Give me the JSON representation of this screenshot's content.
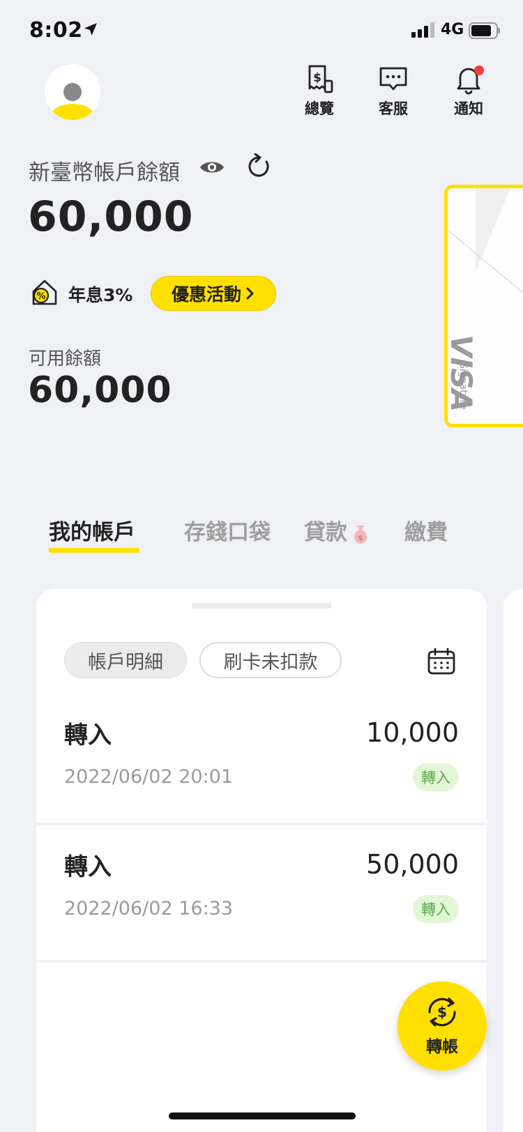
{
  "status_bar": {
    "time": "8:02",
    "network": "4G"
  },
  "header": {
    "overview_label": "總覽",
    "support_label": "客服",
    "notify_label": "通知"
  },
  "balance": {
    "label": "新臺幣帳戶餘額",
    "amount": "60,000",
    "rate": "年息3%",
    "promo_label": "優惠活動",
    "available_label": "可用餘額",
    "available_amount": "60,000"
  },
  "card": {
    "brand": "VISA",
    "tier": "Signature"
  },
  "tabs": [
    {
      "label": "我的帳戶"
    },
    {
      "label": "存錢口袋"
    },
    {
      "label": "貸款"
    },
    {
      "label": "繳費"
    }
  ],
  "filters": {
    "details": "帳戶明細",
    "pending": "刷卡未扣款"
  },
  "transactions": [
    {
      "title": "轉入",
      "amount": "10,000",
      "datetime": "2022/06/02 20:01",
      "tag": "轉入"
    },
    {
      "title": "轉入",
      "amount": "50,000",
      "datetime": "2022/06/02 16:33",
      "tag": "轉入"
    }
  ],
  "fab": {
    "label": "轉帳"
  },
  "colors": {
    "accent": "#ffe000",
    "background": "#eff1f4",
    "tag_bg": "#e3f7d6",
    "tag_text": "#5aa74a",
    "notify_dot": "#f03c3c"
  }
}
